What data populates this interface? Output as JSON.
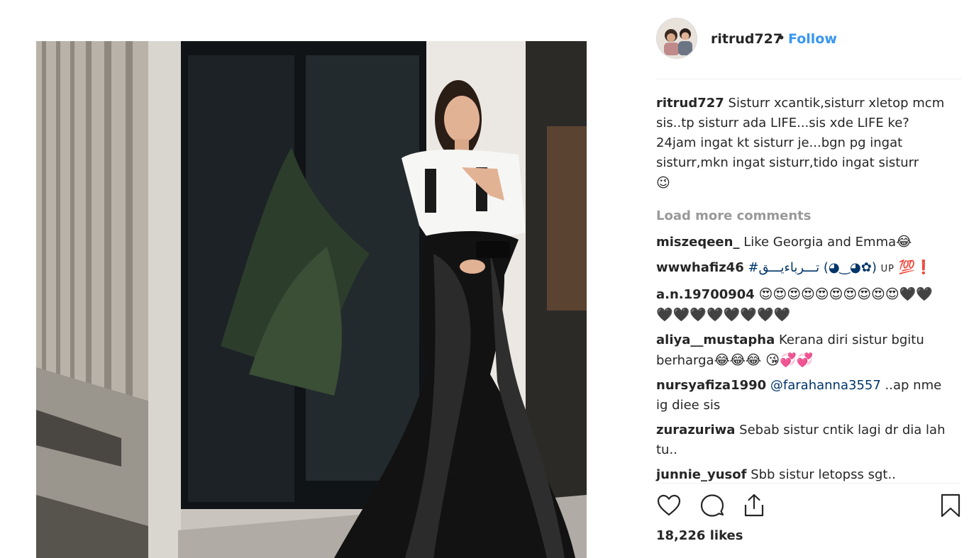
{
  "post": {
    "username": "ritrud727",
    "separator": "•",
    "follow_label": "Follow",
    "caption": {
      "username": "ritrud727",
      "text": "Sisturr xcantik,sisturr xletop mcm sis..tp sisturr ada LIFE...sis xde LIFE ke? 24jam ingat kt sisturr je...bgn pg ingat sisturr,mkn ingat sisturr,tido ingat sisturr",
      "emoji": "😉"
    },
    "load_more_label": "Load more comments",
    "comments": [
      {
        "username": "miszeqeen_",
        "text": "Like Georgia and Emma",
        "emoji": "😂"
      },
      {
        "username": "wwwhafiz46",
        "text": "#تـــرباءيـــق (◕‿◕✿)",
        "up": "UP",
        "emoji": "💯❗"
      },
      {
        "username": "a.n.19700904",
        "text": "",
        "emoji": "😍😍😍😍😍😍😍😍😍😍🖤🖤🖤🖤🖤🖤🖤🖤🖤🖤"
      },
      {
        "username": "aliya__mustapha",
        "text": "Kerana diri sistur bgitu berharga",
        "emoji": "😂😂😂 😘💞💞"
      },
      {
        "username": "nursyafiza1990",
        "mention": "@farahanna3557",
        "text": " ..ap nme ig diee sis",
        "emoji": ""
      },
      {
        "username": "zurazuriwa",
        "text": "Sebab sistur cntik lagi dr dia lah tu..",
        "emoji": ""
      },
      {
        "username": "junnie_yusof",
        "text": "Sbb sistur letopss sgt..",
        "emoji": ""
      }
    ],
    "likes_label": "18,226 likes",
    "actions": {
      "like_icon": "heart-outline-icon",
      "comment_icon": "comment-bubble-icon",
      "share_icon": "share-upload-icon",
      "save_icon": "bookmark-icon"
    }
  },
  "colors": {
    "link_blue": "#3897f0",
    "muted_gray": "#999999",
    "text": "#262626",
    "mention": "#003569"
  }
}
